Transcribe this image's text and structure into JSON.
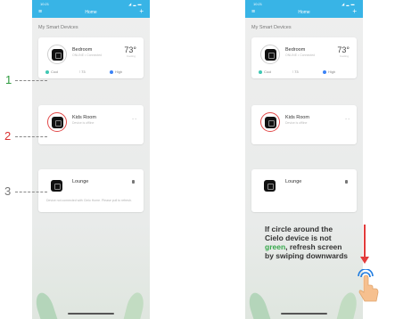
{
  "left_phone": {
    "status": {
      "time": "10:21",
      "signal": "◢ ▂ ▬"
    },
    "nav": {
      "menu_icon": "menu-icon",
      "title": "Home",
      "plus": "+"
    },
    "section_title": "My Smart Devices",
    "devices": [
      {
        "name": "Bedroom",
        "sub": "ONLINE • Connected",
        "temp": "73°",
        "temp_sub": "Cooling",
        "controls": {
          "mode": "Cool",
          "fan": "73",
          "swing": "High"
        }
      },
      {
        "name": "Kids Room",
        "sub": "Device is offline",
        "status_icon": "- -"
      },
      {
        "name": "Lounge",
        "offline_message": "Device not connected with Cielo Home. Please pull to refresh."
      }
    ]
  },
  "right_phone": {
    "status": {
      "time": "10:21",
      "signal": "◢ ▂ ▬"
    },
    "nav": {
      "menu_icon": "menu-icon",
      "title": "Home",
      "plus": "+"
    },
    "section_title": "My Smart Devices",
    "devices": [
      {
        "name": "Bedroom",
        "sub": "ONLINE • Connected",
        "temp": "73°",
        "temp_sub": "Cooling",
        "controls": {
          "mode": "Cool",
          "fan": "73",
          "swing": "High"
        }
      },
      {
        "name": "Kids Room",
        "sub": "Device is offline",
        "status_icon": "- -"
      },
      {
        "name": "Lounge"
      }
    ]
  },
  "callouts": [
    {
      "number": "1",
      "color": "#2e9b3f"
    },
    {
      "number": "2",
      "color": "#d93030"
    },
    {
      "number": "3",
      "color": "#777777"
    }
  ],
  "instruction": {
    "part1": "If circle around the Cielo device is not ",
    "green_word": "green",
    "part2": ", refresh screen by swiping downwards"
  },
  "colors": {
    "accent": "#38b4e6",
    "green": "#35a84a",
    "red": "#e23b3b"
  }
}
